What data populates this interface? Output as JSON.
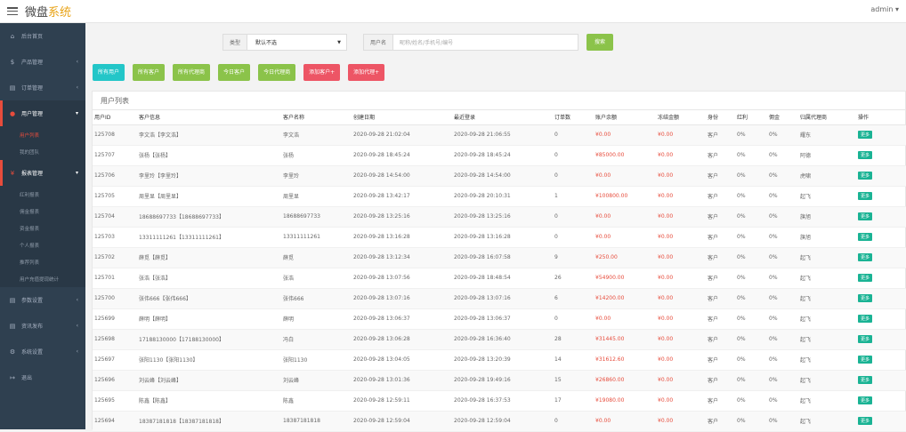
{
  "header": {
    "brand_main": "微盘",
    "brand_accent": "系统",
    "user": "admin ▾"
  },
  "sidebar": {
    "items": [
      {
        "icon": "dashboard-icon",
        "glyph": "⌂",
        "label": "后台首页",
        "arrow": ""
      },
      {
        "icon": "box-icon",
        "glyph": "$",
        "label": "产品管理",
        "arrow": "‹"
      },
      {
        "icon": "order-icon",
        "glyph": "▤",
        "label": "订单管理",
        "arrow": "‹"
      },
      {
        "icon": "user-icon",
        "glyph": "●",
        "label": "用户管理",
        "arrow": "▾",
        "active": true,
        "subs": [
          "用户列表",
          "我的团队"
        ],
        "cur": 0
      },
      {
        "icon": "report-icon",
        "glyph": "¥",
        "label": "报表管理",
        "arrow": "▾",
        "active": true,
        "subs": [
          "红利报表",
          "佣金报表",
          "资金报表",
          "个人报表",
          "推荐列表",
          "用户充值提现统计"
        ],
        "cur": -1
      },
      {
        "icon": "param-icon",
        "glyph": "▤",
        "label": "参数设置",
        "arrow": "‹"
      },
      {
        "icon": "news-icon",
        "glyph": "▤",
        "label": "资讯发布",
        "arrow": "‹"
      },
      {
        "icon": "settings-icon",
        "glyph": "⚙",
        "label": "系统设置",
        "arrow": "‹"
      },
      {
        "icon": "logout-icon",
        "glyph": "↦",
        "label": "退出",
        "arrow": ""
      }
    ]
  },
  "search": {
    "type_label": "类型",
    "type_value": "默认不选",
    "user_label": "用户名",
    "user_placeholder": "昵称/姓名/手机号/编号",
    "submit": "搜索"
  },
  "actions": [
    {
      "label": "所有用户",
      "color": "#23c6c8"
    },
    {
      "label": "所有客户",
      "color": "#8bc34a"
    },
    {
      "label": "所有代理商",
      "color": "#8bc34a"
    },
    {
      "label": "今日客户",
      "color": "#8bc34a"
    },
    {
      "label": "今日代理商",
      "color": "#8bc34a"
    },
    {
      "label": "添加客户+",
      "color": "#ed5565"
    },
    {
      "label": "添加代理+",
      "color": "#ed5565"
    }
  ],
  "panel_title": "用户列表",
  "columns": [
    "用户ID",
    "客户信息",
    "客户名称",
    "创建日期",
    "最近登录",
    "订单数",
    "账户余额",
    "冻结金额",
    "身份",
    "红利",
    "佣金",
    "归属代理商",
    "操作"
  ],
  "rows": [
    [
      "125708",
      "李文浩【李文浩】",
      "李文浩",
      "2020-09-28 21:02:04",
      "2020-09-28 21:06:55",
      "0",
      "¥0.00",
      "¥0.00",
      "客户",
      "0%",
      "0%",
      "耀东",
      "更多"
    ],
    [
      "125707",
      "张杨【张杨】",
      "张杨",
      "2020-09-28 18:45:24",
      "2020-09-28 18:45:24",
      "0",
      "¥85000.00",
      "¥0.00",
      "客户",
      "0%",
      "0%",
      "阿德",
      "更多"
    ],
    [
      "125706",
      "李里玲【李里玲】",
      "李里玲",
      "2020-09-28 14:54:00",
      "2020-09-28 14:54:00",
      "0",
      "¥0.00",
      "¥0.00",
      "客户",
      "0%",
      "0%",
      "虎啸",
      "更多"
    ],
    [
      "125705",
      "周里显【周里显】",
      "周里显",
      "2020-09-28 13:42:17",
      "2020-09-28 20:10:31",
      "1",
      "¥100800.00",
      "¥0.00",
      "客户",
      "0%",
      "0%",
      "起飞",
      "更多"
    ],
    [
      "125704",
      "18688697733【18688697733】",
      "18688697733",
      "2020-09-28 13:25:16",
      "2020-09-28 13:25:16",
      "0",
      "¥0.00",
      "¥0.00",
      "客户",
      "0%",
      "0%",
      "旗旭",
      "更多"
    ],
    [
      "125703",
      "13311111261【13311111261】",
      "13311111261",
      "2020-09-28 13:16:28",
      "2020-09-28 13:16:28",
      "0",
      "¥0.00",
      "¥0.00",
      "客户",
      "0%",
      "0%",
      "旗旭",
      "更多"
    ],
    [
      "125702",
      "薛觅【薛觅】",
      "薛觅",
      "2020-09-28 13:12:34",
      "2020-09-28 16:07:58",
      "9",
      "¥250.00",
      "¥0.00",
      "客户",
      "0%",
      "0%",
      "起飞",
      "更多"
    ],
    [
      "125701",
      "张浩【张浩】",
      "张浩",
      "2020-09-28 13:07:56",
      "2020-09-28 18:48:54",
      "26",
      "¥54900.00",
      "¥0.00",
      "客户",
      "0%",
      "0%",
      "起飞",
      "更多"
    ],
    [
      "125700",
      "张伟666【张伟666】",
      "张伟666",
      "2020-09-28 13:07:16",
      "2020-09-28 13:07:16",
      "6",
      "¥14200.00",
      "¥0.00",
      "客户",
      "0%",
      "0%",
      "起飞",
      "更多"
    ],
    [
      "125699",
      "薛明【薛明】",
      "薛明",
      "2020-09-28 13:06:37",
      "2020-09-28 13:06:37",
      "0",
      "¥0.00",
      "¥0.00",
      "客户",
      "0%",
      "0%",
      "起飞",
      "更多"
    ],
    [
      "125698",
      "17188130000【17188130000】",
      "冯白",
      "2020-09-28 13:06:28",
      "2020-09-28 16:36:40",
      "28",
      "¥31445.00",
      "¥0.00",
      "客户",
      "0%",
      "0%",
      "起飞",
      "更多"
    ],
    [
      "125697",
      "张阳1130【张阳1130】",
      "张阳1130",
      "2020-09-28 13:04:05",
      "2020-09-28 13:20:39",
      "14",
      "¥31612.60",
      "¥0.00",
      "客户",
      "0%",
      "0%",
      "起飞",
      "更多"
    ],
    [
      "125696",
      "刘云峰【刘云峰】",
      "刘云峰",
      "2020-09-28 13:01:36",
      "2020-09-28 19:49:16",
      "15",
      "¥26860.00",
      "¥0.00",
      "客户",
      "0%",
      "0%",
      "起飞",
      "更多"
    ],
    [
      "125695",
      "陈鑫【陈鑫】",
      "陈鑫",
      "2020-09-28 12:59:11",
      "2020-09-28 16:37:53",
      "17",
      "¥19080.00",
      "¥0.00",
      "客户",
      "0%",
      "0%",
      "起飞",
      "更多"
    ],
    [
      "125694",
      "18387181818【18387181818】",
      "18387181818",
      "2020-09-28 12:59:04",
      "2020-09-28 12:59:04",
      "0",
      "¥0.00",
      "¥0.00",
      "客户",
      "0%",
      "0%",
      "起飞",
      "更多"
    ]
  ]
}
